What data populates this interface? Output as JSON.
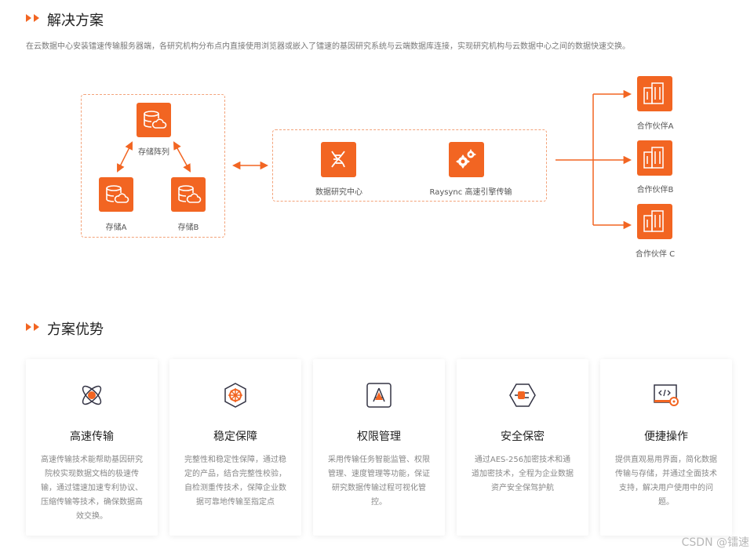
{
  "solution": {
    "title": "解决方案",
    "description": "在云数据中心安装镭速传输服务器端，各研究机构分布点内直接使用浏览器或嵌入了镭速的基因研究系统与云端数据库连接，实现研究机构与云数据中心之间的数据快速交换。"
  },
  "diagram": {
    "storage_array": "存储阵列",
    "storage_a": "存储A",
    "storage_b": "存储B",
    "data_center": "数据研究中心",
    "raysync_engine": "Raysync 高速引擎传输",
    "partner_a": "合作伙伴A",
    "partner_b": "合作伙伴B",
    "partner_c": "合作伙伴 C",
    "accent": "#f26522"
  },
  "advantages": {
    "title": "方案优势",
    "cards": [
      {
        "title": "高速传输",
        "desc": "高速传输技术能帮助基因研究院校实现数据文档的极速传输，通过镭速加速专利协议、压缩传输等技术，确保数据高效交换。",
        "icon": "rocket-icon"
      },
      {
        "title": "稳定保障",
        "desc": "完整性和稳定性保障，通过稳定的产品，结合完整性校验，自检测重传技术，保障企业数据可靠地传输至指定点",
        "icon": "helm-icon"
      },
      {
        "title": "权限管理",
        "desc": "采用传输任务智能监管、权限管理、速度管理等功能，保证研究数据传输过程可视化管控。",
        "icon": "permission-icon"
      },
      {
        "title": "安全保密",
        "desc": "通过AES-256加密技术和通道加密技术，全程为企业数据资产安全保驾护航",
        "icon": "shield-plug-icon"
      },
      {
        "title": "便捷操作",
        "desc": "提供直观易用界面，简化数据传输与存储，并通过全面技术支持，解决用户使用中的问题。",
        "icon": "code-gear-icon"
      }
    ]
  },
  "watermark": "CSDN @镭速"
}
